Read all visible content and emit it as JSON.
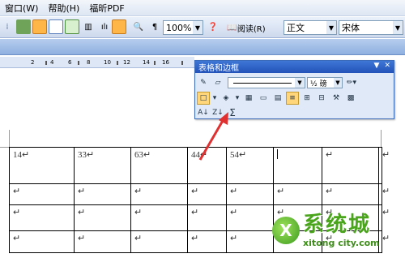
{
  "menu": {
    "items": [
      "窗口(W)",
      "帮助(H)",
      "福昕PDF"
    ]
  },
  "toolbar": {
    "zoom_value": "100%",
    "read_label": "阅读(R)",
    "style_value": "正文",
    "font_value": "宋体"
  },
  "ruler": {
    "ticks": [
      "2",
      "4",
      "6",
      "8",
      "10",
      "12",
      "14",
      "16"
    ]
  },
  "panel": {
    "title": "表格和边框",
    "line_weight": "½ 磅",
    "sum_symbol": "Σ"
  },
  "table": {
    "rows": [
      [
        "14↵",
        "33↵",
        "63↵",
        "44↵",
        "54↵",
        "",
        "↵",
        "↵"
      ],
      [
        "↵",
        "↵",
        "↵",
        "↵",
        "↵",
        "↵",
        "↵",
        "↵"
      ],
      [
        "↵",
        "↵",
        "↵",
        "↵",
        "↵",
        "↵",
        "↵",
        "↵"
      ],
      [
        "↵",
        "↵",
        "↵",
        "↵",
        "↵",
        "↵",
        "↵",
        "↵"
      ]
    ]
  },
  "watermark": {
    "brand": "系统城",
    "url": "xitong city.com"
  },
  "colors": {
    "accent": "#2352b8",
    "annotation": "#e03030",
    "watermark": "#4aa51d"
  }
}
